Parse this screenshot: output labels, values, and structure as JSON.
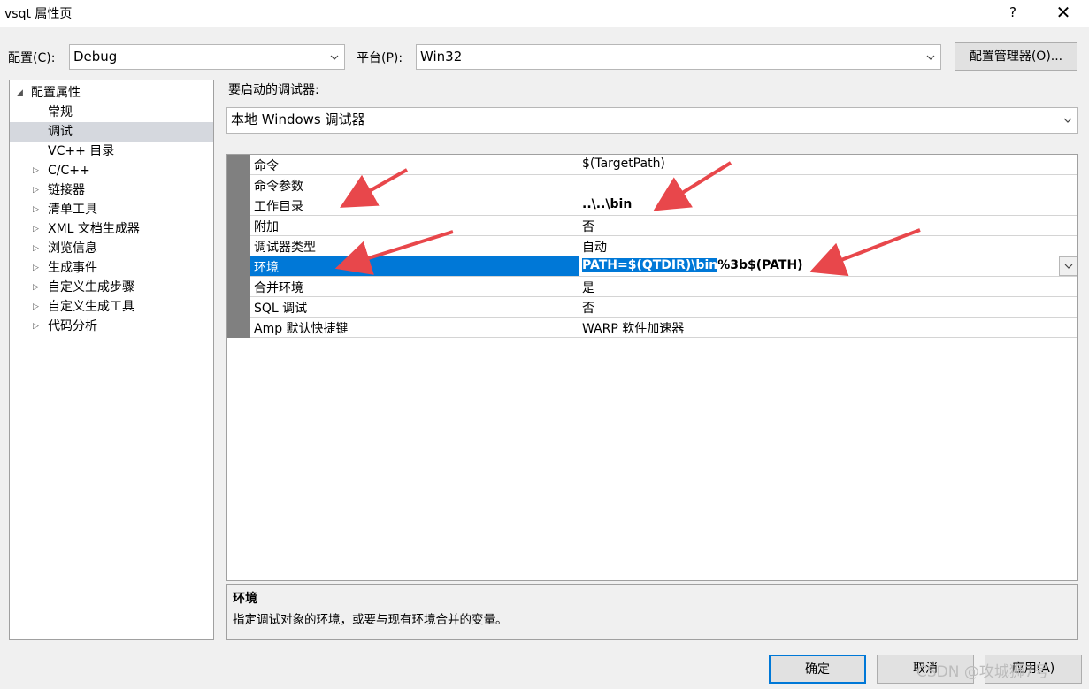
{
  "window": {
    "title": "vsqt 属性页",
    "help": "?",
    "close": "✕"
  },
  "toolbar": {
    "config_label": "配置(C):",
    "config_value": "Debug",
    "platform_label": "平台(P):",
    "platform_value": "Win32",
    "config_manager_label": "配置管理器(O)..."
  },
  "tree": {
    "root": {
      "label": "配置属性",
      "expander": "◢"
    },
    "items": [
      {
        "label": "常规",
        "expander": ""
      },
      {
        "label": "调试",
        "expander": ""
      },
      {
        "label": "VC++ 目录",
        "expander": ""
      },
      {
        "label": "C/C++",
        "expander": "▷"
      },
      {
        "label": "链接器",
        "expander": "▷"
      },
      {
        "label": "清单工具",
        "expander": "▷"
      },
      {
        "label": "XML 文档生成器",
        "expander": "▷"
      },
      {
        "label": "浏览信息",
        "expander": "▷"
      },
      {
        "label": "生成事件",
        "expander": "▷"
      },
      {
        "label": "自定义生成步骤",
        "expander": "▷"
      },
      {
        "label": "自定义生成工具",
        "expander": "▷"
      },
      {
        "label": "代码分析",
        "expander": "▷"
      }
    ]
  },
  "debugger": {
    "label": "要启动的调试器:",
    "value": "本地 Windows 调试器"
  },
  "grid": {
    "rows": [
      {
        "name": "命令",
        "value": "$(TargetPath)"
      },
      {
        "name": "命令参数",
        "value": ""
      },
      {
        "name": "工作目录",
        "value": "..\\..\\bin"
      },
      {
        "name": "附加",
        "value": "否"
      },
      {
        "name": "调试器类型",
        "value": "自动"
      },
      {
        "name": "环境",
        "value_selected": "PATH=$(QTDIR)\\bin",
        "value_rest": "%3b$(PATH)"
      },
      {
        "name": "合并环境",
        "value": "是"
      },
      {
        "name": "SQL 调试",
        "value": "否"
      },
      {
        "name": "Amp 默认快捷键",
        "value": "WARP 软件加速器"
      }
    ]
  },
  "description": {
    "title": "环境",
    "text": "指定调试对象的环境，或要与现有环境合并的变量。"
  },
  "buttons": {
    "ok": "确定",
    "cancel": "取消",
    "apply": "应用(A)"
  },
  "watermark": "CSDN @攻城狮7号",
  "colors": {
    "selection": "#0078d7",
    "arrow": "#e8474b",
    "tree_selected": "#d5d8de"
  }
}
